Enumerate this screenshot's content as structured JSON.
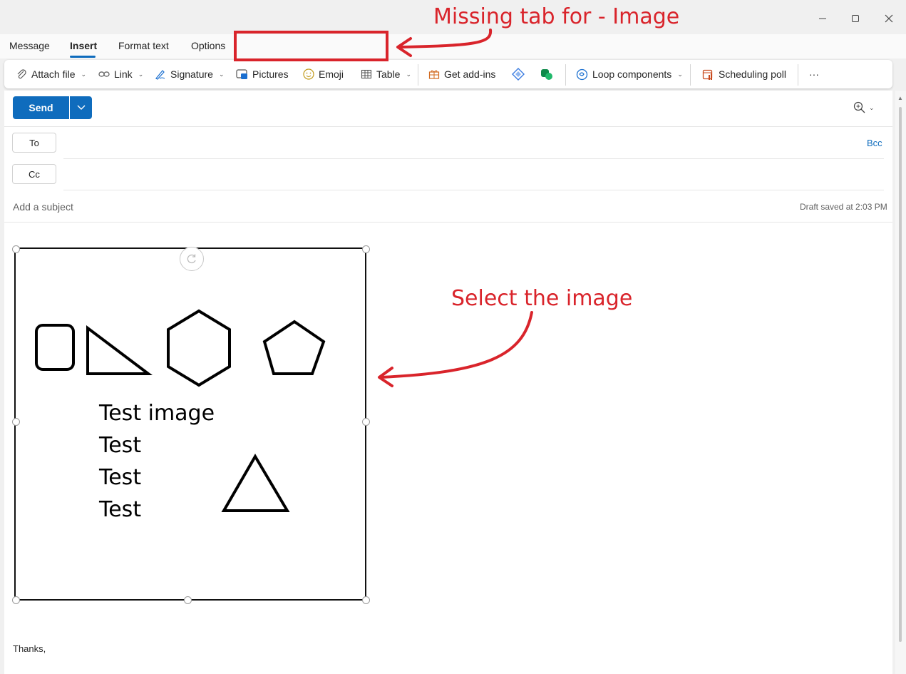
{
  "tabs": [
    {
      "label": "Message"
    },
    {
      "label": "Insert",
      "active": true
    },
    {
      "label": "Format text"
    },
    {
      "label": "Options"
    }
  ],
  "ribbon": {
    "attach_file": "Attach file",
    "link": "Link",
    "signature": "Signature",
    "pictures": "Pictures",
    "emoji": "Emoji",
    "table": "Table",
    "get_addins": "Get add-ins",
    "loop_components": "Loop components",
    "scheduling_poll": "Scheduling poll",
    "more": "···"
  },
  "compose": {
    "send_label": "Send",
    "to_label": "To",
    "cc_label": "Cc",
    "bcc_label": "Bcc",
    "subject_placeholder": "Add a subject",
    "draft_status": "Draft saved at 2:03 PM",
    "body_closing": "Thanks,"
  },
  "image": {
    "lines": [
      "Test image",
      "Test",
      "Test",
      "Test"
    ]
  },
  "annotations": {
    "missing_tab": "Missing tab for - Image",
    "select_image": "Select the image"
  },
  "colors": {
    "accent": "#0f6cbd",
    "annotation_red": "#d9242b"
  }
}
